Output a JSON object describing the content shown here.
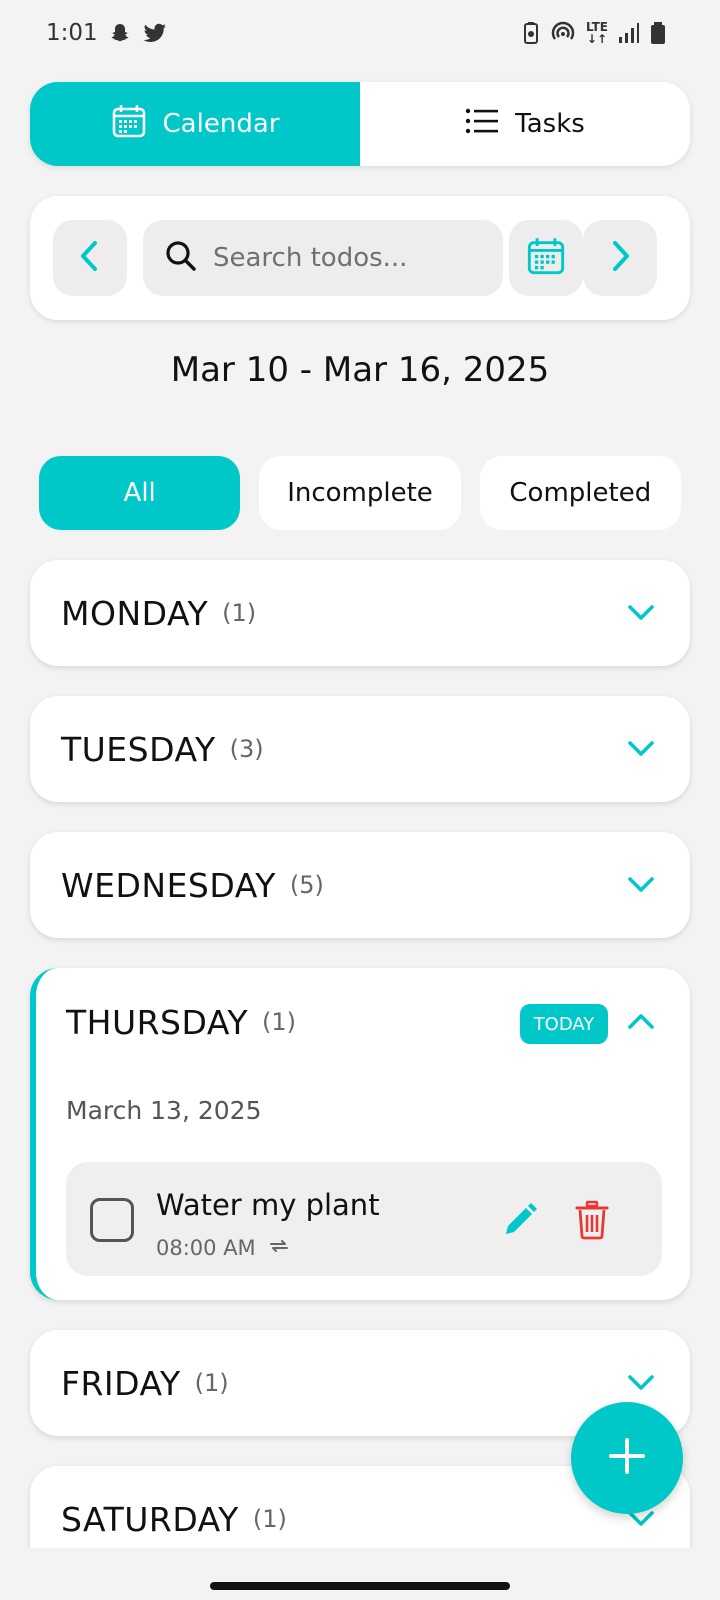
{
  "status_bar": {
    "time": "1:01",
    "lte_label": "LTE"
  },
  "tabs": [
    {
      "label": "Calendar",
      "active": true,
      "icon": "calendar-icon"
    },
    {
      "label": "Tasks",
      "active": false,
      "icon": "list-icon"
    }
  ],
  "search": {
    "placeholder": "Search todos..."
  },
  "date_range": "Mar 10 - Mar 16, 2025",
  "filters": [
    {
      "label": "All",
      "active": true
    },
    {
      "label": "Incomplete",
      "active": false
    },
    {
      "label": "Completed",
      "active": false
    }
  ],
  "days": {
    "monday": {
      "name": "MONDAY",
      "count": "(1)"
    },
    "tuesday": {
      "name": "TUESDAY",
      "count": "(3)"
    },
    "wednesday": {
      "name": "WEDNESDAY",
      "count": "(5)"
    },
    "thursday": {
      "name": "THURSDAY",
      "count": "(1)",
      "badge": "TODAY",
      "full_date": "March 13, 2025",
      "todos": [
        {
          "title": "Water my plant",
          "time": "08:00 AM",
          "repeat": true,
          "completed": false
        }
      ]
    },
    "friday": {
      "name": "FRIDAY",
      "count": "(1)"
    },
    "saturday": {
      "name": "SATURDAY",
      "count": "(1)"
    }
  },
  "colors": {
    "accent": "#00c8c8",
    "danger": "#e53935",
    "background": "#f3f3f3"
  }
}
